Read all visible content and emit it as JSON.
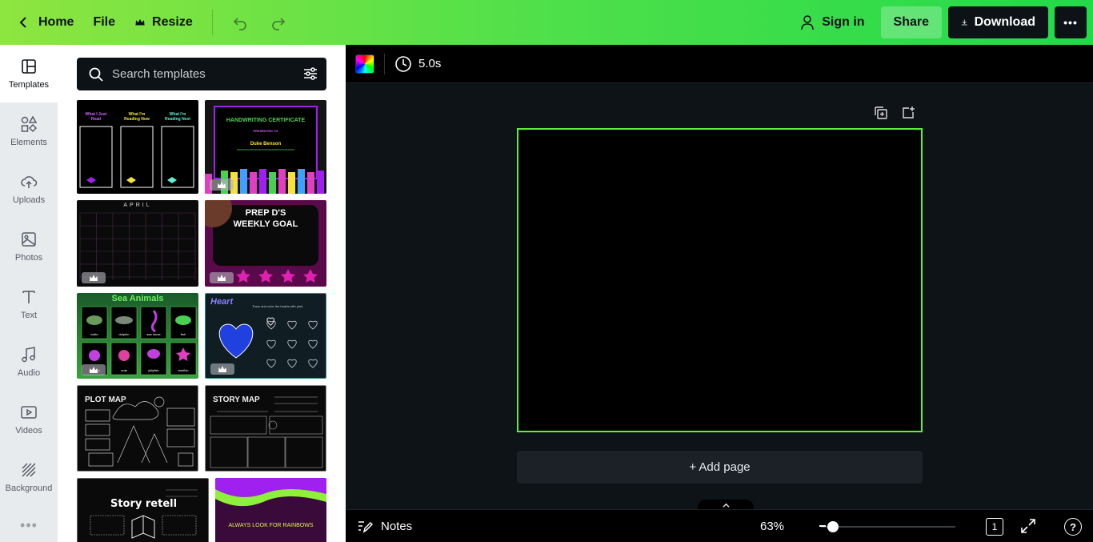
{
  "topbar": {
    "home_label": "Home",
    "file_label": "File",
    "resize_label": "Resize",
    "signin_label": "Sign in",
    "share_label": "Share",
    "download_label": "Download",
    "more_label": "•••"
  },
  "rail": {
    "items": [
      {
        "label": "Templates",
        "icon": "templates-icon",
        "active": true
      },
      {
        "label": "Elements",
        "icon": "elements-icon"
      },
      {
        "label": "Uploads",
        "icon": "upload-cloud-icon"
      },
      {
        "label": "Photos",
        "icon": "image-icon"
      },
      {
        "label": "Text",
        "icon": "text-T-icon"
      },
      {
        "label": "Audio",
        "icon": "music-note-icon"
      },
      {
        "label": "Videos",
        "icon": "video-icon"
      },
      {
        "label": "Background",
        "icon": "background-stripes-icon"
      }
    ],
    "more_label": "•••"
  },
  "panel": {
    "search_placeholder": "Search templates",
    "templates": [
      {
        "name": "reading-columns",
        "heading1": "What I Just Read",
        "heading2": "What I'm Reading Now",
        "heading3": "What I'm Reading Next",
        "premium": true
      },
      {
        "name": "handwriting-certificate",
        "title": "HANDWRITING CERTIFICATE",
        "subtitle": "PRESENTED TO",
        "person": "Duke Benson",
        "premium": true
      },
      {
        "name": "april-calendar",
        "title": "APRIL",
        "premium": true
      },
      {
        "name": "weekly-goal",
        "title_line1": "PREP D'S",
        "title_line2": "WEEKLY GOAL",
        "premium": true
      },
      {
        "name": "sea-animals",
        "title": "Sea Animals",
        "labels": [
          "turtle",
          "dolphin",
          "sea horse",
          "fish",
          "octopus",
          "crab",
          "jellyfish",
          "starfish"
        ],
        "premium": true
      },
      {
        "name": "heart-worksheet",
        "title": "Heart",
        "instruction": "Trace and color the hearts with pink.",
        "premium": true
      },
      {
        "name": "plot-map",
        "title": "PLOT MAP",
        "premium": false
      },
      {
        "name": "story-map",
        "title": "STORY MAP",
        "premium": false
      },
      {
        "name": "story-retell",
        "title": "Story retell",
        "premium": false
      },
      {
        "name": "rainbows",
        "title": "ALWAYS LOOK FOR RAINBOWS",
        "premium": false
      }
    ]
  },
  "editor": {
    "duration": "5.0s",
    "add_page_label": "+ Add page",
    "canvas_border_color": "#5df03a"
  },
  "bottombar": {
    "notes_label": "Notes",
    "zoom": "63%",
    "page_count": "1",
    "help": "?"
  },
  "colors": {
    "topbar_start": "#8ee53f",
    "topbar_end": "#22d94a",
    "accent_green": "#5df03a",
    "dark": "#0d1216"
  }
}
